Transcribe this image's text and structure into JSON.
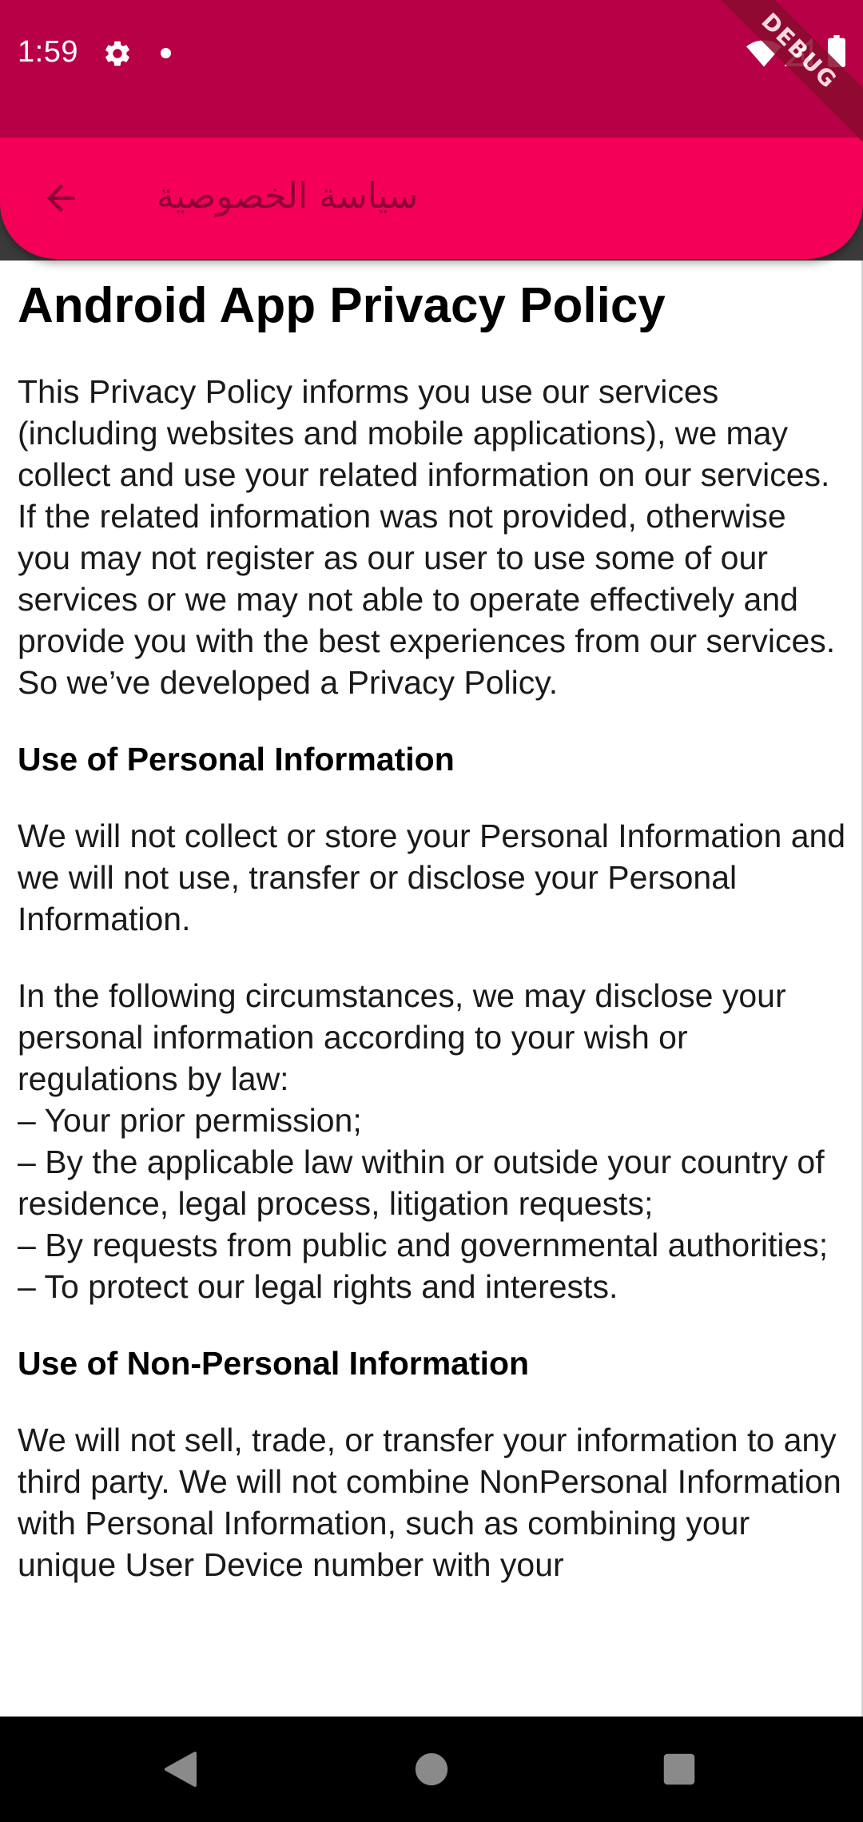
{
  "status_bar": {
    "time": "1:59",
    "debug_label": "DEBUG",
    "icons": [
      "gear-icon",
      "notification-dot-icon",
      "wifi-icon",
      "signal-icon",
      "battery-icon"
    ]
  },
  "app_bar": {
    "title": "سياسة الخصوصية",
    "back_icon": "arrow-back-icon",
    "background_color": "#f50057",
    "title_color": "#8c0033"
  },
  "document": {
    "title": "Android App Privacy Policy",
    "intro": "This Privacy Policy informs you use our services (including websites and mobile applications), we may collect and use your related information on our services. If the related information was not provided, otherwise you may not register as our user to use some of our services or we may not able to operate effectively and provide you with the best experiences from our services. So we’ve developed a Privacy Policy.",
    "section1": {
      "heading": "Use of Personal Information",
      "para1": "We will not collect or store your Personal Information and we will not use, transfer or disclose your Personal Information.",
      "para2": "In the following circumstances, we may disclose your personal information according to your wish or regulations by law:",
      "bullets": [
        "– Your prior permission;",
        "– By the applicable law within or outside your country of residence, legal process, litigation requests;",
        "– By requests from public and governmental authorities;",
        "– To protect our legal rights and interests."
      ]
    },
    "section2": {
      "heading": "Use of Non-Personal Information",
      "para1": "We will not sell, trade, or transfer your information to any third party. We will not combine NonPersonal Information with Personal Information, such as combining your unique User Device number with your"
    }
  },
  "nav_bar": {
    "icons": [
      "back-triangle-icon",
      "home-circle-icon",
      "recents-square-icon"
    ]
  },
  "colors": {
    "status_bar": "#b80046",
    "accent": "#f50057"
  }
}
